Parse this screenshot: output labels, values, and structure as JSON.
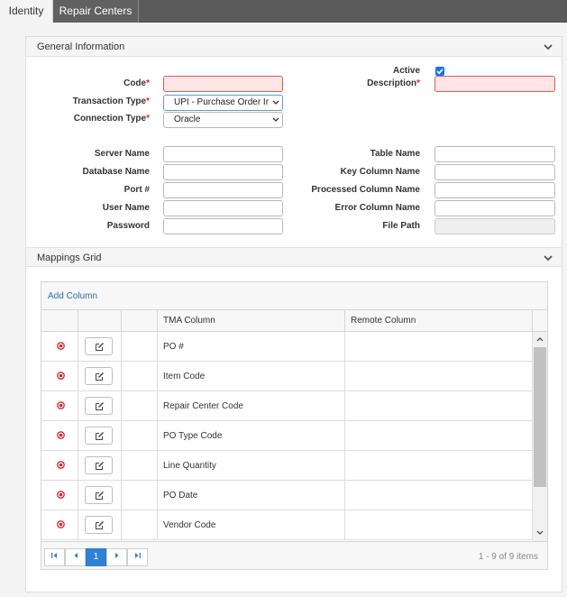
{
  "tabs": [
    {
      "label": "Identity",
      "active": true
    },
    {
      "label": "Repair Centers",
      "active": false
    }
  ],
  "general": {
    "title": "General Information",
    "code_label": "Code",
    "code_value": "",
    "transaction_type_label": "Transaction Type",
    "transaction_type_value": "UPI - Purchase Order Ir",
    "connection_type_label": "Connection Type",
    "connection_type_value": "Oracle",
    "active_label": "Active",
    "active_checked": true,
    "description_label": "Description",
    "description_value": "",
    "required_mark": "*",
    "server_name_label": "Server Name",
    "database_name_label": "Database Name",
    "port_label": "Port #",
    "user_name_label": "User Name",
    "password_label": "Password",
    "table_name_label": "Table Name",
    "key_column_label": "Key Column Name",
    "processed_column_label": "Processed Column Name",
    "error_column_label": "Error Column Name",
    "file_path_label": "File Path"
  },
  "mappings": {
    "title": "Mappings Grid",
    "add_column_label": "Add Column",
    "headers": [
      "",
      "",
      "",
      "TMA Column",
      "Remote Column"
    ],
    "rows": [
      {
        "tma": "PO #",
        "remote": ""
      },
      {
        "tma": "Item Code",
        "remote": ""
      },
      {
        "tma": "Repair Center Code",
        "remote": ""
      },
      {
        "tma": "PO Type Code",
        "remote": ""
      },
      {
        "tma": "Line Quantity",
        "remote": ""
      },
      {
        "tma": "PO Date",
        "remote": ""
      },
      {
        "tma": "Vendor Code",
        "remote": ""
      }
    ],
    "pager": {
      "current_page": "1",
      "info": "1 - 9 of 9 items"
    }
  },
  "colors": {
    "accent": "#2f80d0",
    "required": "#d9262b",
    "error_fill": "#ffe5e5"
  }
}
